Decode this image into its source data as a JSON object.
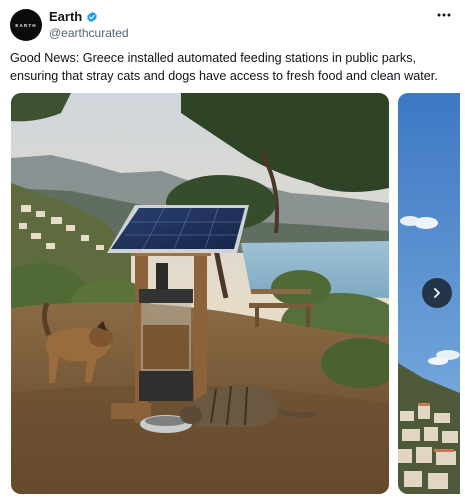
{
  "author": {
    "avatar_text": "EARTH",
    "display_name": "Earth",
    "handle": "@earthcurated",
    "verified_icon": "verified-badge-icon"
  },
  "tweet": {
    "text": "Good News: Greece installed automated feeding stations in public parks, ensuring that stray cats and dogs have access to fresh food and clean water."
  },
  "media": {
    "photo_1_subject": "solar-powered feeding station with dog and cat",
    "photo_2_subject": "coastal town with blue sky",
    "next_icon": "chevron-right-icon",
    "more_icon": "more-options-icon"
  },
  "colors": {
    "text": "#0f1419",
    "secondary_text": "#536471",
    "verified_blue": "#1d9bf0",
    "sky": "#dcd8cf",
    "sea": "#8fb6cc"
  }
}
